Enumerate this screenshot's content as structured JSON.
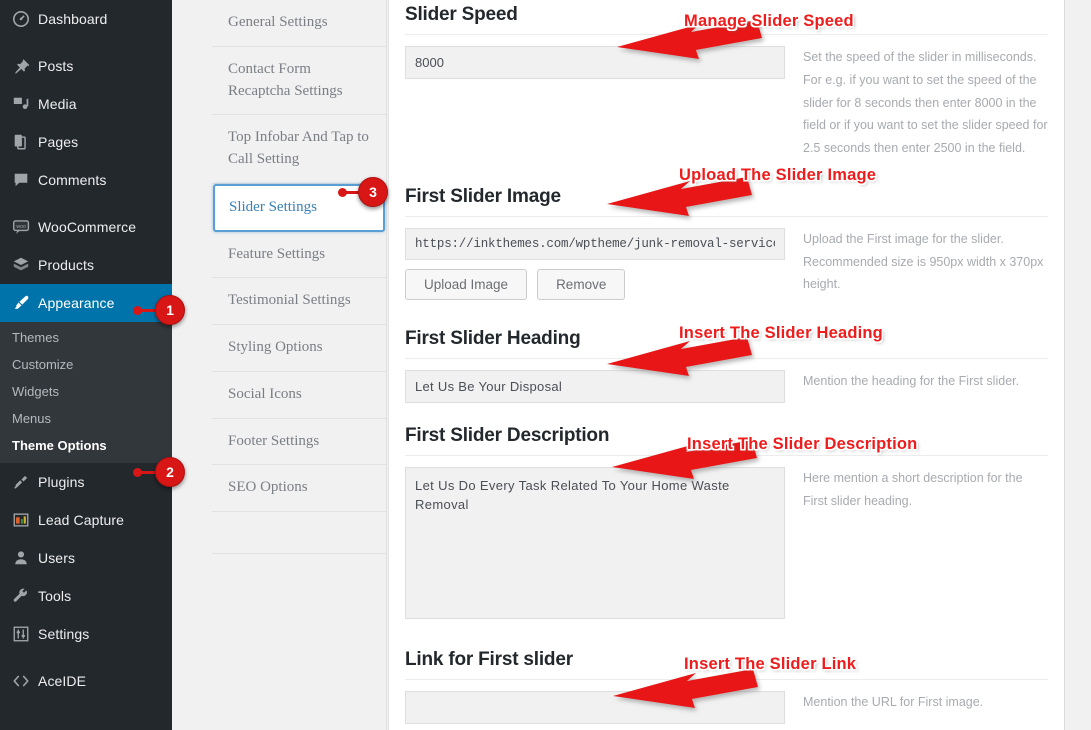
{
  "adminmenu": {
    "items": [
      {
        "label": "Dashboard",
        "icon": "dashboard-icon"
      },
      {
        "label": "Posts",
        "icon": "pin-icon"
      },
      {
        "label": "Media",
        "icon": "media-icon"
      },
      {
        "label": "Pages",
        "icon": "pages-icon"
      },
      {
        "label": "Comments",
        "icon": "comment-icon"
      },
      {
        "label": "WooCommerce",
        "icon": "woocommerce-icon"
      },
      {
        "label": "Products",
        "icon": "products-icon"
      },
      {
        "label": "Appearance",
        "icon": "appearance-brush-icon"
      },
      {
        "label": "Plugins",
        "icon": "plugins-plug-icon"
      },
      {
        "label": "Lead Capture",
        "icon": "lead-capture-icon"
      },
      {
        "label": "Users",
        "icon": "users-icon"
      },
      {
        "label": "Tools",
        "icon": "tools-wrench-icon"
      },
      {
        "label": "Settings",
        "icon": "settings-sliders-icon"
      },
      {
        "label": "AceIDE",
        "icon": "code-brackets-icon"
      }
    ],
    "appearance_submenu": [
      {
        "label": "Themes"
      },
      {
        "label": "Customize"
      },
      {
        "label": "Widgets"
      },
      {
        "label": "Menus"
      },
      {
        "label": "Theme Options"
      }
    ]
  },
  "settings_nav": {
    "items": [
      {
        "label": "General Settings"
      },
      {
        "label": "Contact Form Recaptcha Settings"
      },
      {
        "label": "Top Infobar And Tap to Call Setting"
      },
      {
        "label": "Slider Settings"
      },
      {
        "label": "Feature Settings"
      },
      {
        "label": "Testimonial Settings"
      },
      {
        "label": "Styling Options"
      },
      {
        "label": "Social Icons"
      },
      {
        "label": "Footer Settings"
      },
      {
        "label": "SEO Options"
      }
    ]
  },
  "fields": {
    "slider_speed": {
      "title": "Slider Speed",
      "value": "8000",
      "placeholder": "",
      "help": "Set the speed of the slider in milliseconds. For e.g. if you want to set the speed of the slider for 8 seconds then enter 8000 in the field or if you want to set the slider speed for 2.5 seconds then enter 2500 in the field."
    },
    "first_slider_image": {
      "title": "First Slider Image",
      "value": "https://inkthemes.com/wptheme/junk-removal-service-",
      "placeholder": "",
      "upload_label": "Upload Image",
      "remove_label": "Remove",
      "help": "Upload the First image for the slider. Recommended size is 950px width x 370px height."
    },
    "first_slider_heading": {
      "title": "First Slider Heading",
      "value": "Let Us Be Your Disposal",
      "placeholder": "",
      "help": "Mention the heading for the First slider."
    },
    "first_slider_description": {
      "title": "First Slider Description",
      "value": "Let Us Do Every Task Related To Your Home Waste Removal",
      "placeholder": "",
      "help": "Here mention a short description for the First slider heading."
    },
    "link_for_first_slider": {
      "title": "Link for First slider",
      "value": "",
      "placeholder": "",
      "help": "Mention the URL for First image."
    }
  },
  "annotations": {
    "callouts": [
      {
        "text": "Manage Slider Speed"
      },
      {
        "text": "Upload The Slider Image"
      },
      {
        "text": "Insert The Slider Heading"
      },
      {
        "text": "Insert The Slider Description"
      },
      {
        "text": "Insert The Slider Link"
      }
    ],
    "badges": [
      {
        "number": "1"
      },
      {
        "number": "2"
      },
      {
        "number": "3"
      }
    ],
    "accent_color": "#ee1c1c",
    "badge_color": "#d81616"
  },
  "theme": {
    "sidebar_bg": "#23282d",
    "submenu_bg": "#32373c",
    "current_bg": "#0073aa",
    "panel_bg": "#ffffff",
    "input_bg": "#f1f1f1",
    "nav_link_color": "#3a7fb5"
  }
}
